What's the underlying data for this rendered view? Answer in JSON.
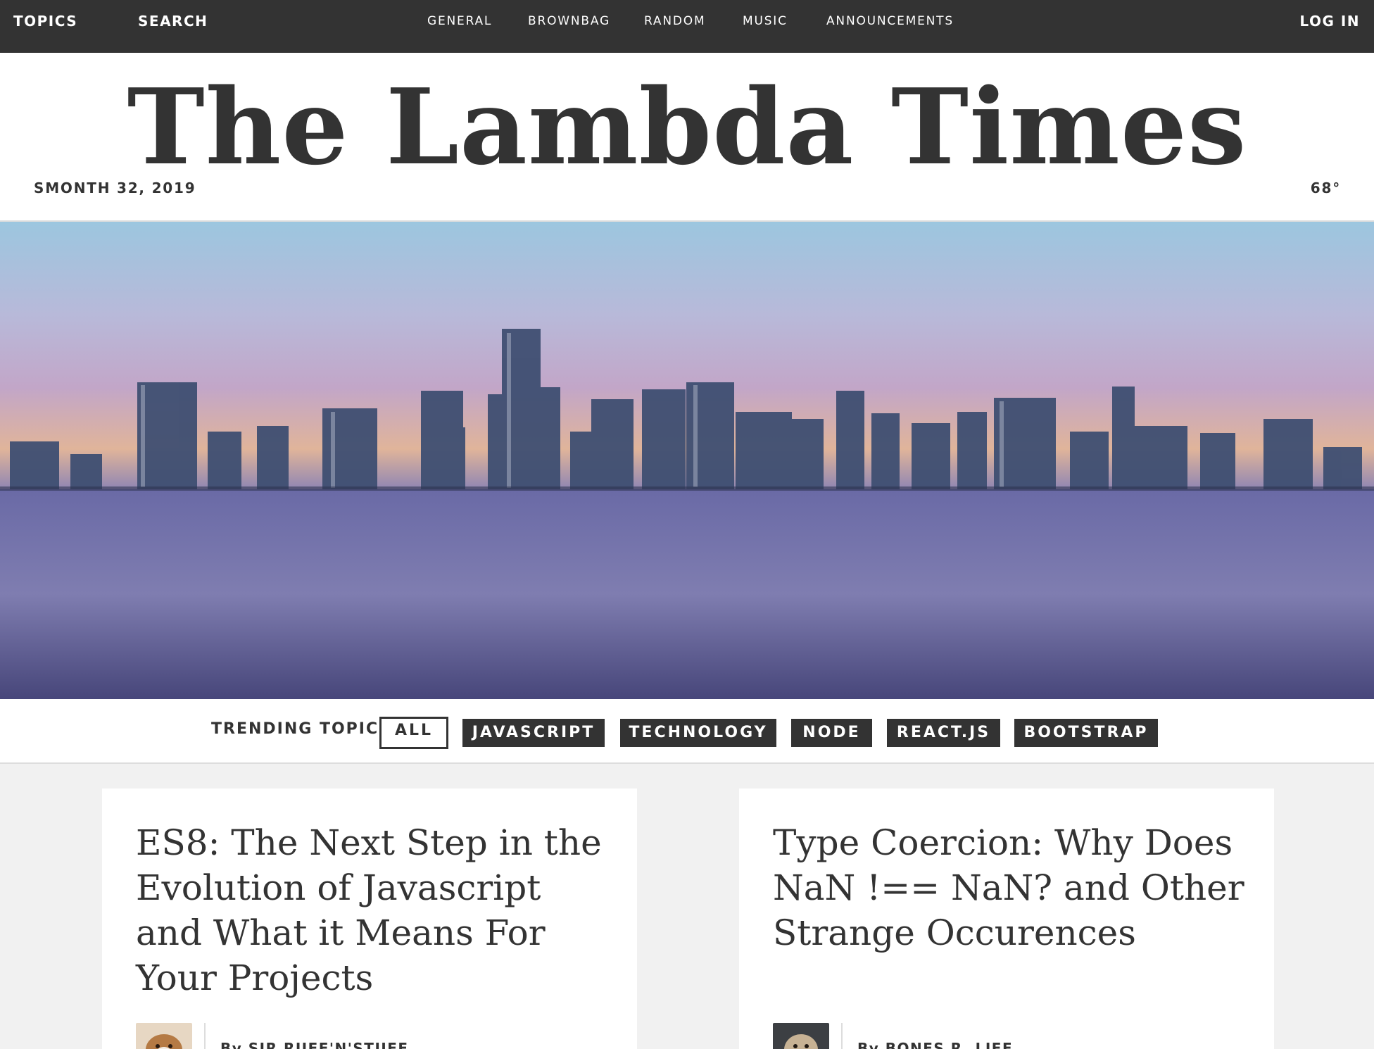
{
  "topbar": {
    "topics": "TOPICS",
    "search": "SEARCH",
    "nav": [
      "GENERAL",
      "BROWNBAG",
      "RANDOM",
      "MUSIC",
      "ANNOUNCEMENTS"
    ],
    "login": "LOG IN"
  },
  "header": {
    "title": "The Lambda Times",
    "date": "SMONTH 32, 2019",
    "temperature": "68°"
  },
  "trending": {
    "label": "TRENDING TOPICS:",
    "tabs": [
      "ALL",
      "JAVASCRIPT",
      "TECHNOLOGY",
      "NODE",
      "REACT.JS",
      "BOOTSTRAP"
    ],
    "active_tab": "ALL"
  },
  "cards": [
    {
      "headline": "ES8: The Next Step in the Evolution of Javascript and What it Means For Your Projects",
      "byline": "By SIR RUFF'N'STUFF"
    },
    {
      "headline": "Type Coercion: Why Does NaN !== NaN? and Other Strange Occurences",
      "byline": "By BONES R. LIFE"
    }
  ],
  "colors": {
    "dark": "#333333",
    "panel": "#f1f1f1",
    "white": "#ffffff"
  }
}
